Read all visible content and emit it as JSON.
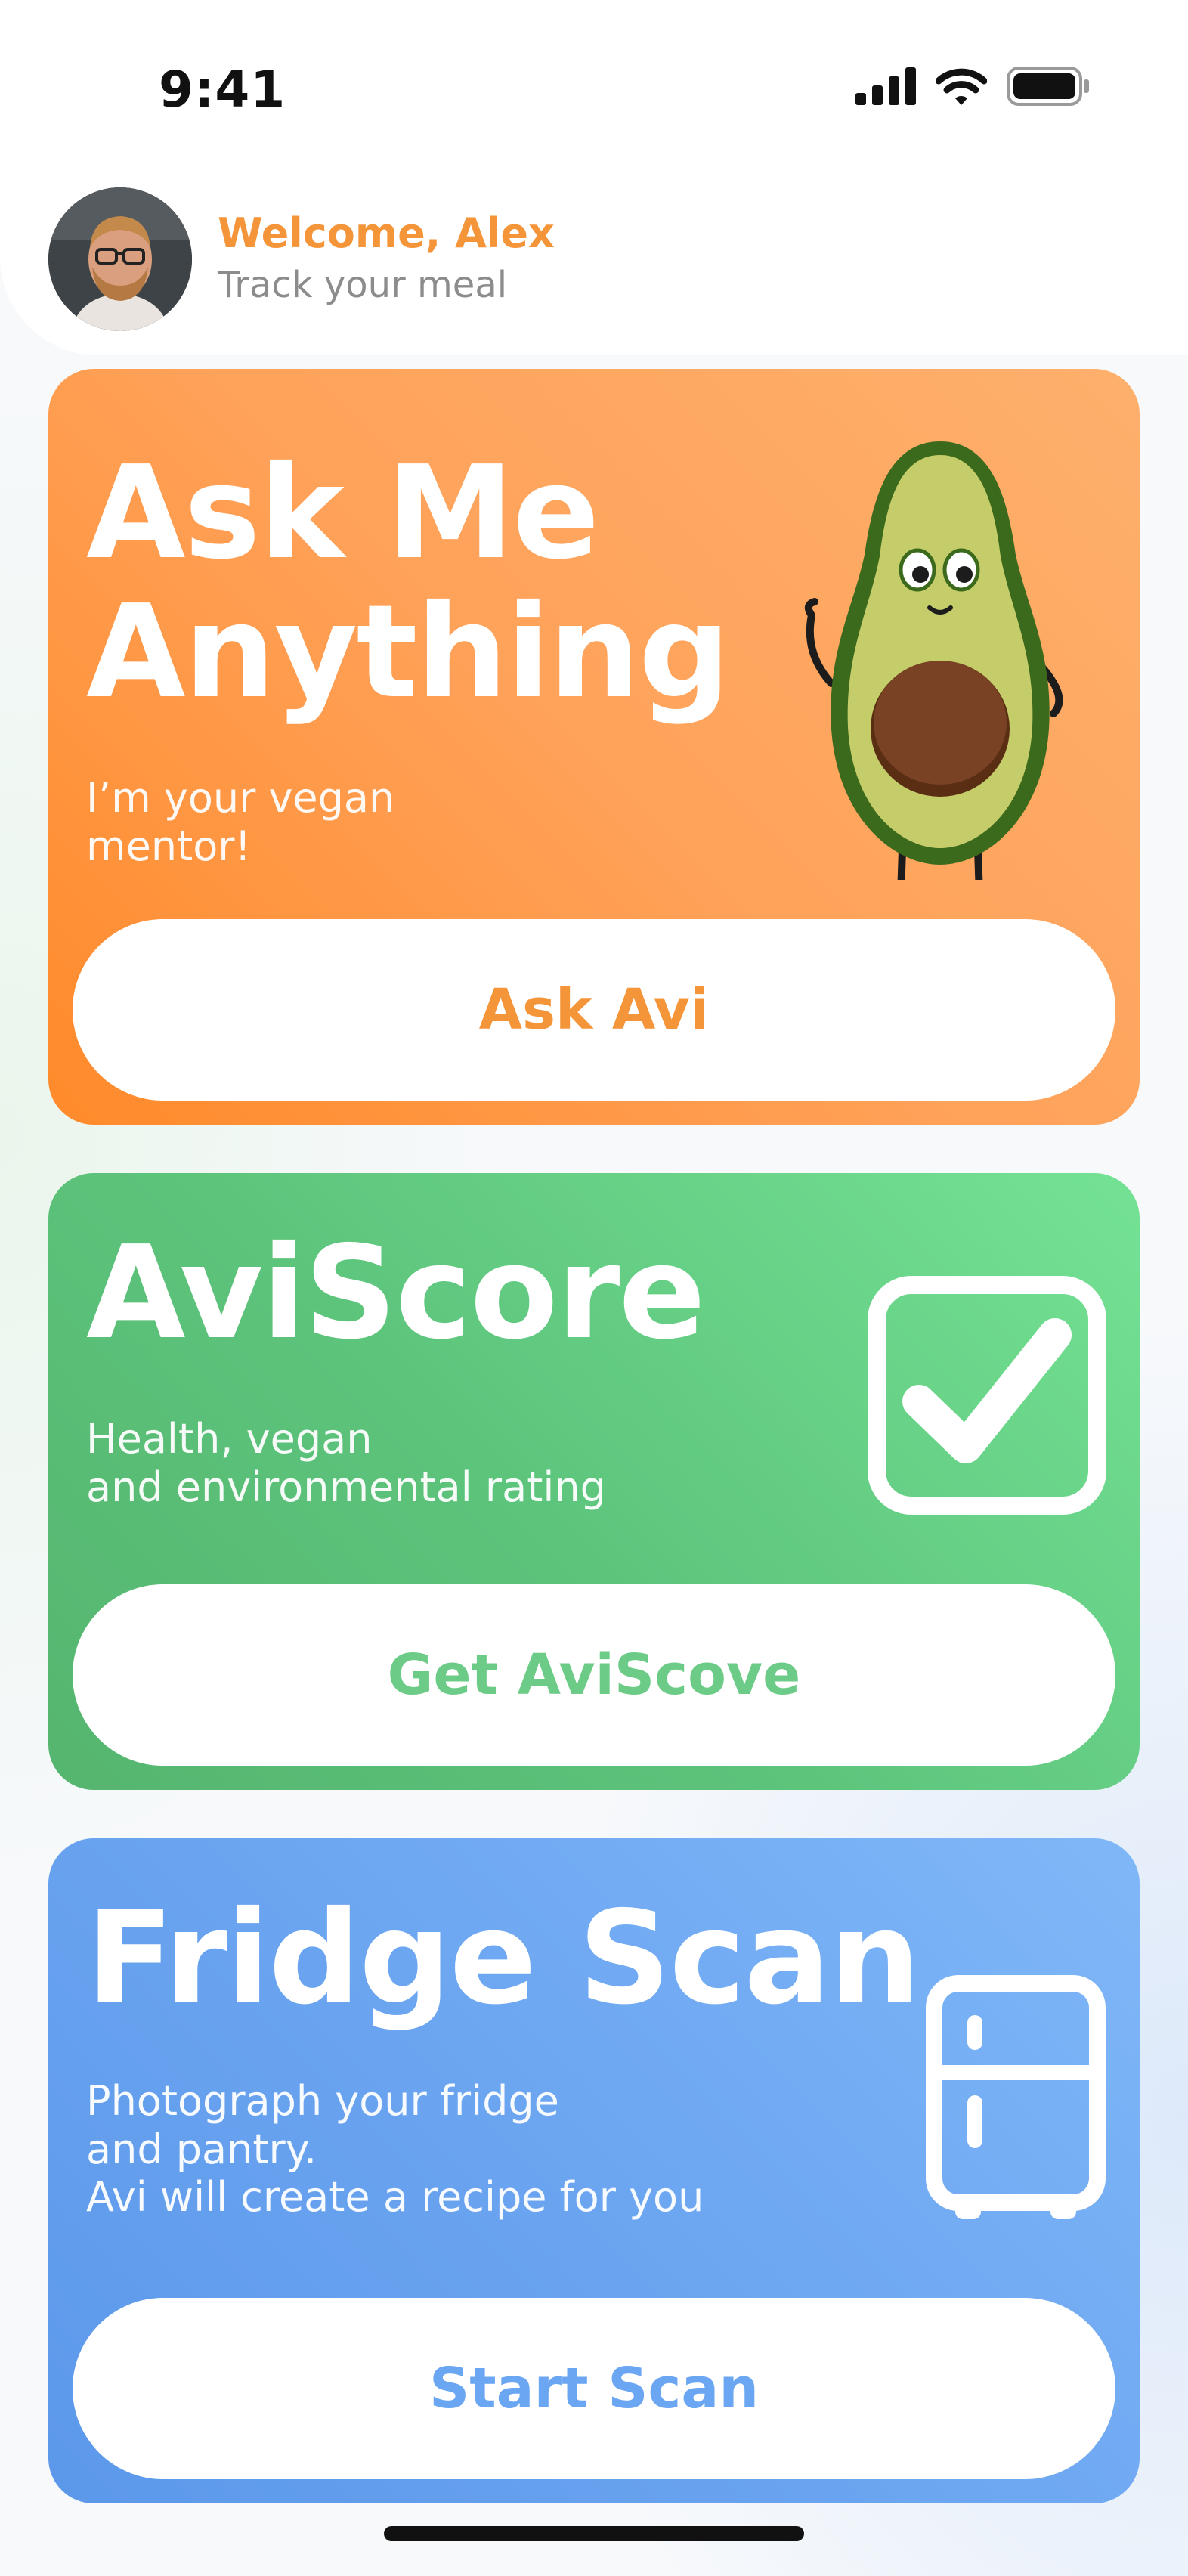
{
  "status_bar": {
    "time": "9:41"
  },
  "header": {
    "welcome": "Welcome, Alex",
    "subtitle": "Track your meal"
  },
  "cards": [
    {
      "title": "Ask Me\nAnything",
      "description": "I’m your vegan\nmentor!",
      "button": "Ask Avi",
      "accent": "#f5953a",
      "icon": "avocado-mascot"
    },
    {
      "title": "AviScore",
      "description": "Health, vegan\nand environmental rating",
      "button": "Get AviScove",
      "accent": "#6ccb87",
      "icon": "checkbox-icon"
    },
    {
      "title": "Fridge Scan",
      "description": "Photograph your fridge\nand pantry.\nAvi will create a recipe for you",
      "button": "Start Scan",
      "accent": "#6aa6f2",
      "icon": "fridge-icon"
    }
  ],
  "colors": {
    "orange": "#f5953a",
    "green": "#6ccb87",
    "blue": "#6aa6f2"
  }
}
